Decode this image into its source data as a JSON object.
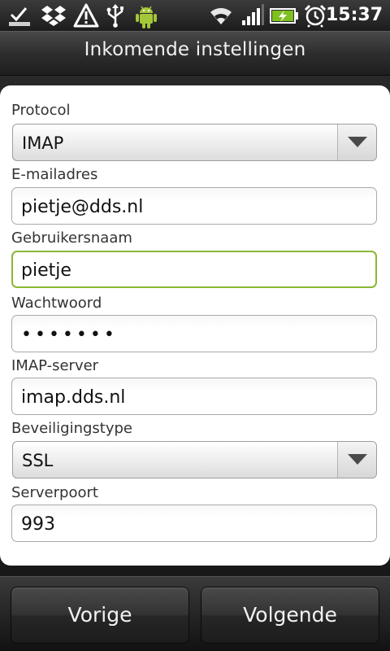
{
  "status_bar": {
    "time": "15:37",
    "icons": [
      "sync-icon",
      "dropbox-icon",
      "warning-icon",
      "usb-icon",
      "android-icon",
      "wifi-icon",
      "signal-icon",
      "battery-icon",
      "alarm-icon"
    ]
  },
  "header": {
    "title": "Inkomende instellingen"
  },
  "form": {
    "protocol": {
      "label": "Protocol",
      "value": "IMAP"
    },
    "email": {
      "label": "E-mailadres",
      "value": "pietje@dds.nl"
    },
    "username": {
      "label": "Gebruikersnaam",
      "value": "pietje"
    },
    "password": {
      "label": "Wachtwoord",
      "value": "•••••••"
    },
    "server": {
      "label": "IMAP-server",
      "value": "imap.dds.nl"
    },
    "security": {
      "label": "Beveiligingstype",
      "value": "SSL"
    },
    "port": {
      "label": "Serverpoort",
      "value": "993"
    }
  },
  "footer": {
    "previous_label": "Vorige",
    "next_label": "Volgende"
  },
  "colors": {
    "focus_border": "#8bb733",
    "battery_charge": "#7ec01f",
    "android_green": "#a4c639"
  }
}
